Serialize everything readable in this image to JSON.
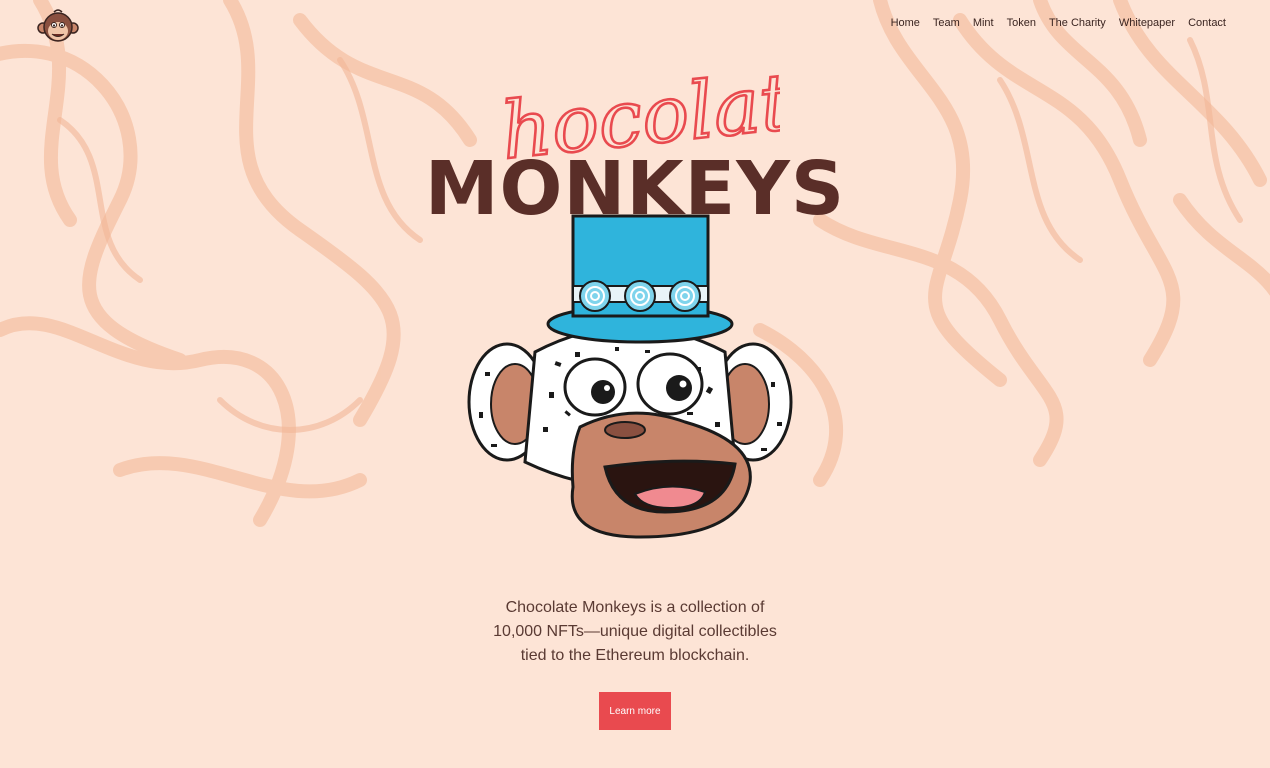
{
  "header": {
    "logo_icon": "monkey-head-logo-icon",
    "nav": [
      {
        "label": "Home"
      },
      {
        "label": "Team"
      },
      {
        "label": "Mint"
      },
      {
        "label": "Token"
      },
      {
        "label": "The Charity"
      },
      {
        "label": "Whitepaper"
      },
      {
        "label": "Contact"
      }
    ]
  },
  "hero": {
    "script_title": "Chocolate",
    "title": "MONKEYS",
    "description_lines": [
      "Chocolate Monkeys is a collection of",
      "10,000 NFTs—unique digital collectibles",
      "tied to the Ethereum blockchain."
    ],
    "cta_label": "Learn more"
  },
  "colors": {
    "background": "#fde4d6",
    "swirl": "#f6c2a6",
    "script_red": "#e94a4f",
    "title_brown": "#5a2e28",
    "hat_blue": "#2fb4dc",
    "button": "#e94a4f"
  }
}
